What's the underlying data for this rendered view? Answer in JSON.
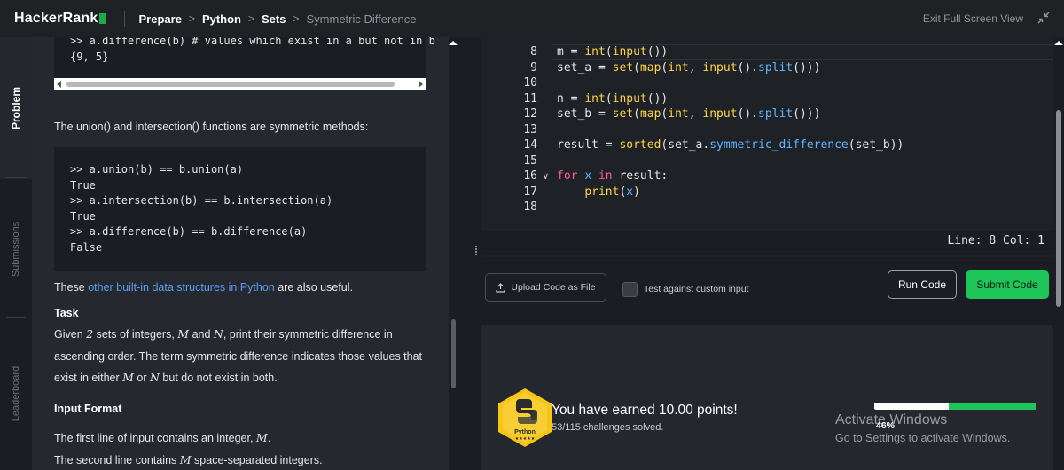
{
  "topbar": {
    "logo": "HackerRank",
    "breadcrumbs": [
      "Prepare",
      "Python",
      "Sets"
    ],
    "current": "Symmetric Difference",
    "exit_fullscreen": "Exit Full Screen View"
  },
  "sidebar_tabs": [
    "Problem",
    "Submissions",
    "Leaderboard"
  ],
  "problem": {
    "top_code": [
      ">> a.difference(b) # values which exist in a but not in b",
      "{9, 5}"
    ],
    "intro": "The union() and intersection() functions are symmetric methods:",
    "code2": [
      ">> a.union(b) == b.union(a)",
      "True",
      ">> a.intersection(b) == b.intersection(a)",
      "True",
      ">> a.difference(b) == b.difference(a)",
      "False"
    ],
    "also_prefix": "These ",
    "also_link": "other built-in data structures in Python",
    "also_suffix": " are also useful.",
    "task_heading": "Task",
    "task_p1": "Given ",
    "task_n2": "2",
    "task_p2": " sets of integers, ",
    "task_M": "M",
    "task_and": " and ",
    "task_N": "N",
    "task_p3": ", print their symmetric difference in",
    "task_line2": "ascending order. The term symmetric difference indicates those values that",
    "task_line3a": "exist in either ",
    "task_or": " or ",
    "task_line3b": " but do not exist in both.",
    "input_heading": "Input Format",
    "input_l1a": "The first line of input contains an integer, ",
    "input_l1b": ".",
    "input_l2a": "The second line contains ",
    "input_l2b": " space-separated integers."
  },
  "editor": {
    "lines": [
      {
        "n": "8",
        "code": "m = int(input())"
      },
      {
        "n": "9",
        "code": "set_a = set(map(int, input().split()))"
      },
      {
        "n": "10",
        "code": ""
      },
      {
        "n": "11",
        "code": "n = int(input())"
      },
      {
        "n": "12",
        "code": "set_b = set(map(int, input().split()))"
      },
      {
        "n": "13",
        "code": ""
      },
      {
        "n": "14",
        "code": "result = sorted(set_a.symmetric_difference(set_b))"
      },
      {
        "n": "15",
        "code": ""
      },
      {
        "n": "16",
        "code": "for x in result:"
      },
      {
        "n": "17",
        "code": "    print(x)"
      },
      {
        "n": "18",
        "code": ""
      }
    ],
    "status": "Line: 8 Col: 1"
  },
  "actions": {
    "upload": "Upload Code as File",
    "custom_input": "Test against custom input",
    "run": "Run Code",
    "submit": "Submit Code"
  },
  "result": {
    "badge_label": "Python",
    "earned": "You have earned 10.00 points!",
    "solved": "53/115 challenges solved.",
    "progress_pct": "46%",
    "progress_value": 0.46,
    "watermark_title": "Activate Windows",
    "watermark_sub": "Go to Settings to activate Windows."
  },
  "colors": {
    "brand_green": "#1ec65a",
    "link": "#5c9ef2",
    "keyword": "#ff5c8d",
    "function": "#ffd24a",
    "variable": "#61b4ff"
  }
}
